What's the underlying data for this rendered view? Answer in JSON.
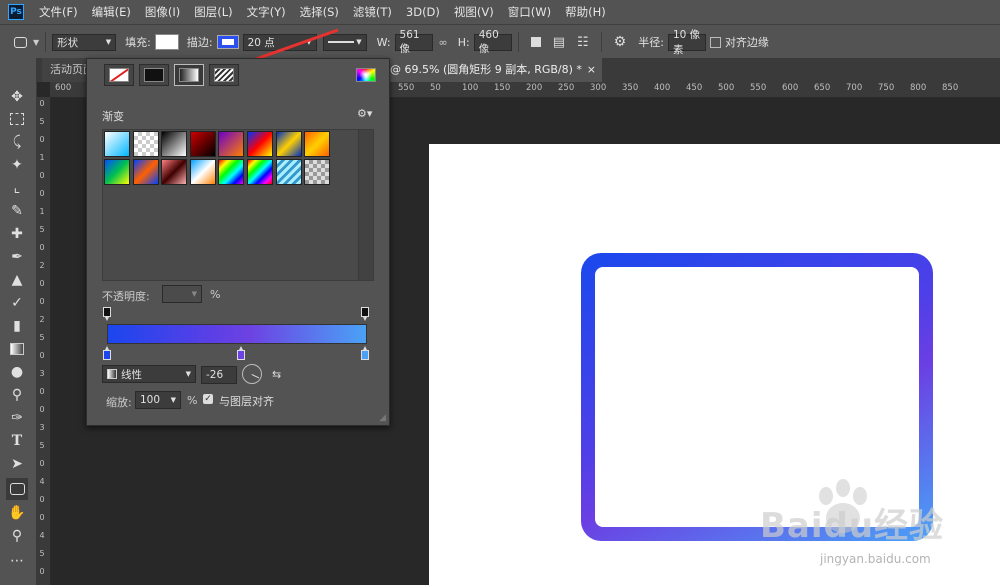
{
  "app": {
    "logo": "Ps"
  },
  "menu": [
    "文件(F)",
    "编辑(E)",
    "图像(I)",
    "图层(L)",
    "文字(Y)",
    "选择(S)",
    "滤镜(T)",
    "3D(D)",
    "视图(V)",
    "窗口(W)",
    "帮助(H)"
  ],
  "options": {
    "mode": "形状",
    "fill_label": "填充:",
    "stroke_label": "描边:",
    "stroke_width": "20 点",
    "w_label": "W:",
    "w_value": "561 像",
    "h_label": "H:",
    "h_value": "460 像",
    "radius_label": "半径:",
    "radius_value": "10 像素",
    "align_edges": "对齐边缘"
  },
  "tabs": {
    "active_doc": "活动页面",
    "current_doc": "@ 69.5% (圆角矩形 9 副本, RGB/8) *",
    "close": "×"
  },
  "ruler_top": [
    "600",
    "550",
    "50",
    "100",
    "150",
    "200",
    "250",
    "300",
    "350",
    "400",
    "450",
    "500",
    "550",
    "600",
    "650",
    "700",
    "750",
    "800",
    "850"
  ],
  "ruler_left": [
    "0",
    "5",
    "0",
    "1",
    "0",
    "0",
    "1",
    "5",
    "0",
    "2",
    "0",
    "0",
    "2",
    "5",
    "0",
    "3",
    "0",
    "0",
    "3",
    "5",
    "0",
    "4",
    "0",
    "0",
    "4",
    "5",
    "0"
  ],
  "panel": {
    "gradient_title": "渐变",
    "opacity_label": "不透明度:",
    "opacity_unit": "%",
    "style": "线性",
    "angle": "-26",
    "scale_label": "缩放:",
    "scale_value": "100",
    "scale_unit": "%",
    "align_layer": "与图层对齐",
    "align_layer_checked": true
  },
  "colors": {
    "gradient_start": "#1b46ee",
    "gradient_mid": "#6d42e2",
    "gradient_end": "#4aa2f7",
    "annotation_arrow": "#e8322f"
  },
  "watermark": {
    "brand": "Baidu经验",
    "url": "jingyan.baidu.com"
  }
}
